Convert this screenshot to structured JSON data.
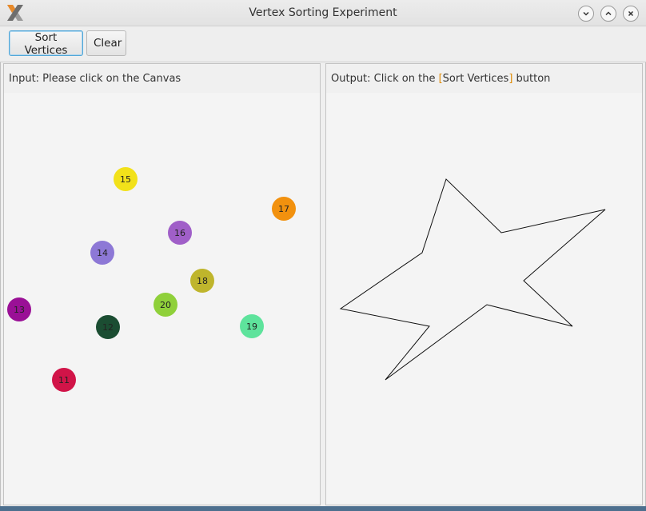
{
  "window": {
    "title": "Vertex Sorting Experiment",
    "controls": [
      "minimize",
      "maximize",
      "close"
    ]
  },
  "toolbar": {
    "sort_label": "Sort Vertices",
    "clear_label": "Clear"
  },
  "input_panel": {
    "header": "Input: Please click on the Canvas",
    "vertices": [
      {
        "label": "11",
        "color": "#d11448"
      },
      {
        "label": "12",
        "color": "#1b4d32"
      },
      {
        "label": "13",
        "color": "#9a1096"
      },
      {
        "label": "14",
        "color": "#8d78d6"
      },
      {
        "label": "15",
        "color": "#f2e11a"
      },
      {
        "label": "16",
        "color": "#a05fc8"
      },
      {
        "label": "17",
        "color": "#f2910e"
      },
      {
        "label": "18",
        "color": "#bfb52c"
      },
      {
        "label": "19",
        "color": "#5ee39c"
      },
      {
        "label": "20",
        "color": "#8fd03a"
      }
    ]
  },
  "output_panel": {
    "header_prefix": "Output: Click on the",
    "header_button_ref": "Sort Vertices",
    "header_suffix": "button"
  },
  "colors": {
    "accent": "#52a7d8",
    "taskbar": "#4d6f8e"
  }
}
